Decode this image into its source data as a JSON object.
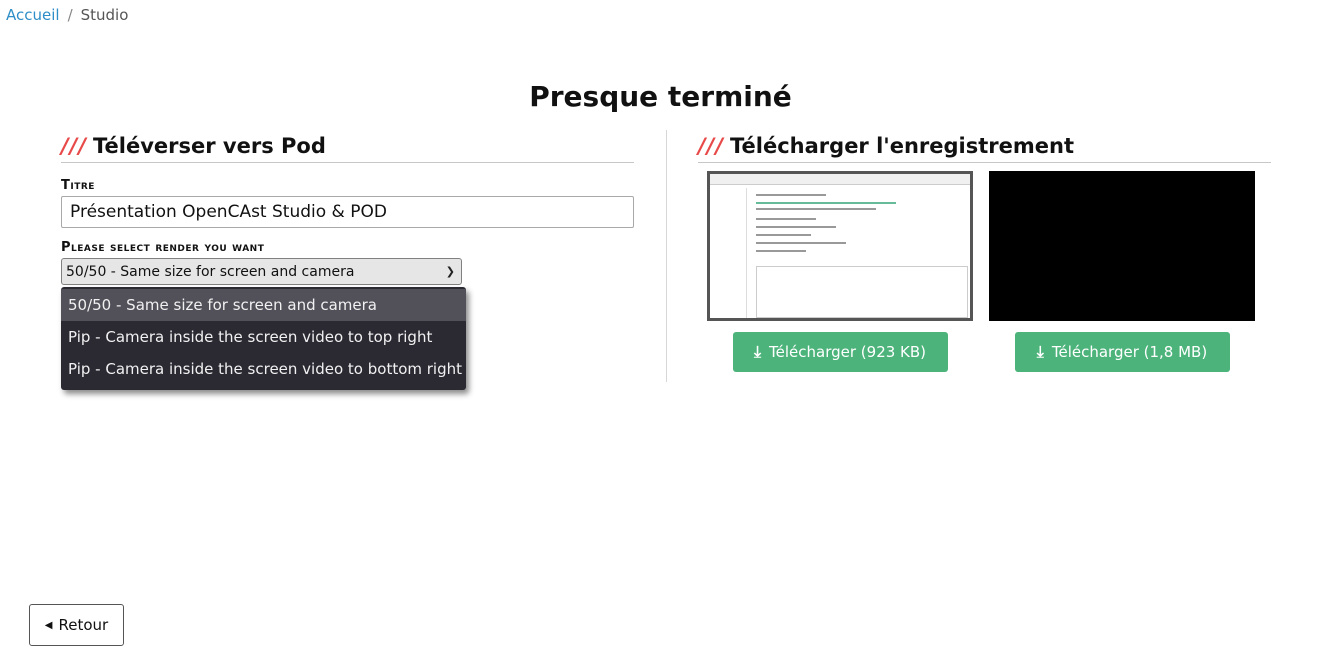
{
  "breadcrumb": {
    "home": "Accueil",
    "separator": "/",
    "current": "Studio"
  },
  "page_title": "Presque terminé",
  "upload": {
    "heading_mark": "///",
    "heading": "Téléverser vers Pod",
    "title_label": "Titre",
    "title_value": "Présentation OpenCAst Studio & POD",
    "render_label": "Please select render you want",
    "render_selected": "50/50 - Same size for screen and camera",
    "render_options": [
      "50/50 - Same size for screen and camera",
      "Pip - Camera inside the screen video to top right",
      "Pip - Camera inside the screen video to bottom right"
    ]
  },
  "download": {
    "heading_mark": "///",
    "heading": "Télécharger l'enregistrement",
    "buttons": [
      {
        "label": "Télécharger (923 KB)",
        "icon": "download-icon"
      },
      {
        "label": "Télécharger (1,8 MB)",
        "icon": "download-icon"
      }
    ]
  },
  "back_button": {
    "label": "Retour",
    "icon": "caret-left-icon"
  },
  "colors": {
    "accent_slashes": "#e84a4a",
    "download_button": "#4cb37b",
    "link": "#2e8ec7",
    "dropdown_bg": "#2b2a33"
  }
}
